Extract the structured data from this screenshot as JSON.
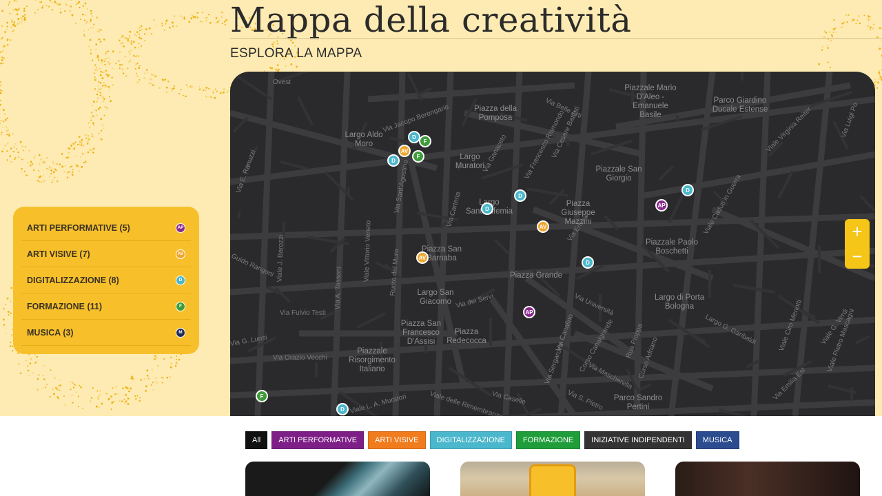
{
  "page": {
    "title": "Mappa della creatività",
    "subtitle": "ESPLORA LA MAPPA"
  },
  "colors": {
    "arti_performative": "#8a2b8e",
    "arti_visive": "#f0a52c",
    "digitalizzazione": "#4bb7cc",
    "formazione": "#3e9c3a",
    "musica": "#1f2a55",
    "accent": "#f7c02b"
  },
  "legend": {
    "items": [
      {
        "label": "ARTI PERFORMATIVE (5)",
        "code": "AP",
        "color": "#8a2b8e"
      },
      {
        "label": "ARTI VISIVE (7)",
        "code": "AV",
        "color": "#f0a52c"
      },
      {
        "label": "DIGITALIZZAZIONE (8)",
        "code": "D",
        "color": "#4bb7cc"
      },
      {
        "label": "FORMAZIONE (11)",
        "code": "F",
        "color": "#3e9c3a"
      },
      {
        "label": "MUSICA (3)",
        "code": "M",
        "color": "#1f2a55"
      }
    ]
  },
  "map": {
    "places": [
      "Largo Aldo Moro",
      "Piazza della Pomposa",
      "Largo Muratori",
      "Largo Sant'Eufemia",
      "Piazzale San Giorgio",
      "Piazza Giuseppe Mazzini",
      "Piazzale Mario D'Aleo - Emanuele Basile",
      "Parco Giardino Ducale Estense",
      "Piazza San Barnaba",
      "Piazzale Paolo Boschetti",
      "Piazza Grande",
      "Largo San Giacomo",
      "Largo di Porta Bologna",
      "Piazza San Francesco D'Assisi",
      "Piazza Redecocca",
      "Piazzale Risorgimento Italiano",
      "Parco Sandro Pertini"
    ],
    "streets": [
      "Via Jacopo Berengario",
      "Via Belle Arti",
      "Via Francesco Rismondo",
      "Via Cesare Battisti",
      "Via Ganaceto",
      "Via Sant'Agostino",
      "Viale Vittorio Veneto",
      "Via Carteria",
      "Via Emilia",
      "Viale Virginia Reiter",
      "Viale Caduti in Guerra",
      "Viale J. Barozzi",
      "Via Fulvio Testi",
      "Via dei Servi",
      "Via Università",
      "Via Canalino",
      "Corso Canalgrande",
      "Rua Pioppa",
      "Corso Adriano",
      "Viale Ciro Menotti",
      "Viale delle Rimembranze",
      "Via Caselle",
      "Via S. Pietro",
      "Via Mascherella",
      "Largo G. Garibaldi",
      "Viale Pietro Mascagni",
      "Via Emilia Est",
      "Viale G. Verdi",
      "Via Orazio Vecchi",
      "Via G. Luosi",
      "Guido Rangoni",
      "Via E. Ranuzzi",
      "Via A. Tassoni",
      "Ovest",
      "Via Luigi Po",
      "Viale L. A. Muratori",
      "Via Sergaroza",
      "Ruoto del Muro"
    ],
    "markers": [
      {
        "code": "D",
        "color": "#4bb7cc"
      },
      {
        "code": "F",
        "color": "#3e9c3a"
      },
      {
        "code": "AV",
        "color": "#f0a52c"
      },
      {
        "code": "F",
        "color": "#3e9c3a"
      },
      {
        "code": "D",
        "color": "#4bb7cc"
      },
      {
        "code": "D",
        "color": "#4bb7cc"
      },
      {
        "code": "D",
        "color": "#4bb7cc"
      },
      {
        "code": "AV",
        "color": "#f0a52c"
      },
      {
        "code": "AP",
        "color": "#8a2b8e"
      },
      {
        "code": "D",
        "color": "#4bb7cc"
      },
      {
        "code": "AV",
        "color": "#f0a52c"
      },
      {
        "code": "D",
        "color": "#4bb7cc"
      },
      {
        "code": "AP",
        "color": "#8a2b8e"
      },
      {
        "code": "F",
        "color": "#3e9c3a"
      },
      {
        "code": "D",
        "color": "#4bb7cc"
      }
    ],
    "zoom_in": "+",
    "zoom_out": "−"
  },
  "filters": [
    {
      "label": "All",
      "color": "#111111"
    },
    {
      "label": "ARTI PERFORMATIVE",
      "color": "#7d1f86"
    },
    {
      "label": "ARTI VISIVE",
      "color": "#f07c1e"
    },
    {
      "label": "DIGITALIZZAZIONE",
      "color": "#4bb7cc"
    },
    {
      "label": "FORMAZIONE",
      "color": "#1f9d3a"
    },
    {
      "label": "INIZIATIVE INDIPENDENTI",
      "color": "#333333"
    },
    {
      "label": "MUSICA",
      "color": "#2b4c8e"
    }
  ]
}
